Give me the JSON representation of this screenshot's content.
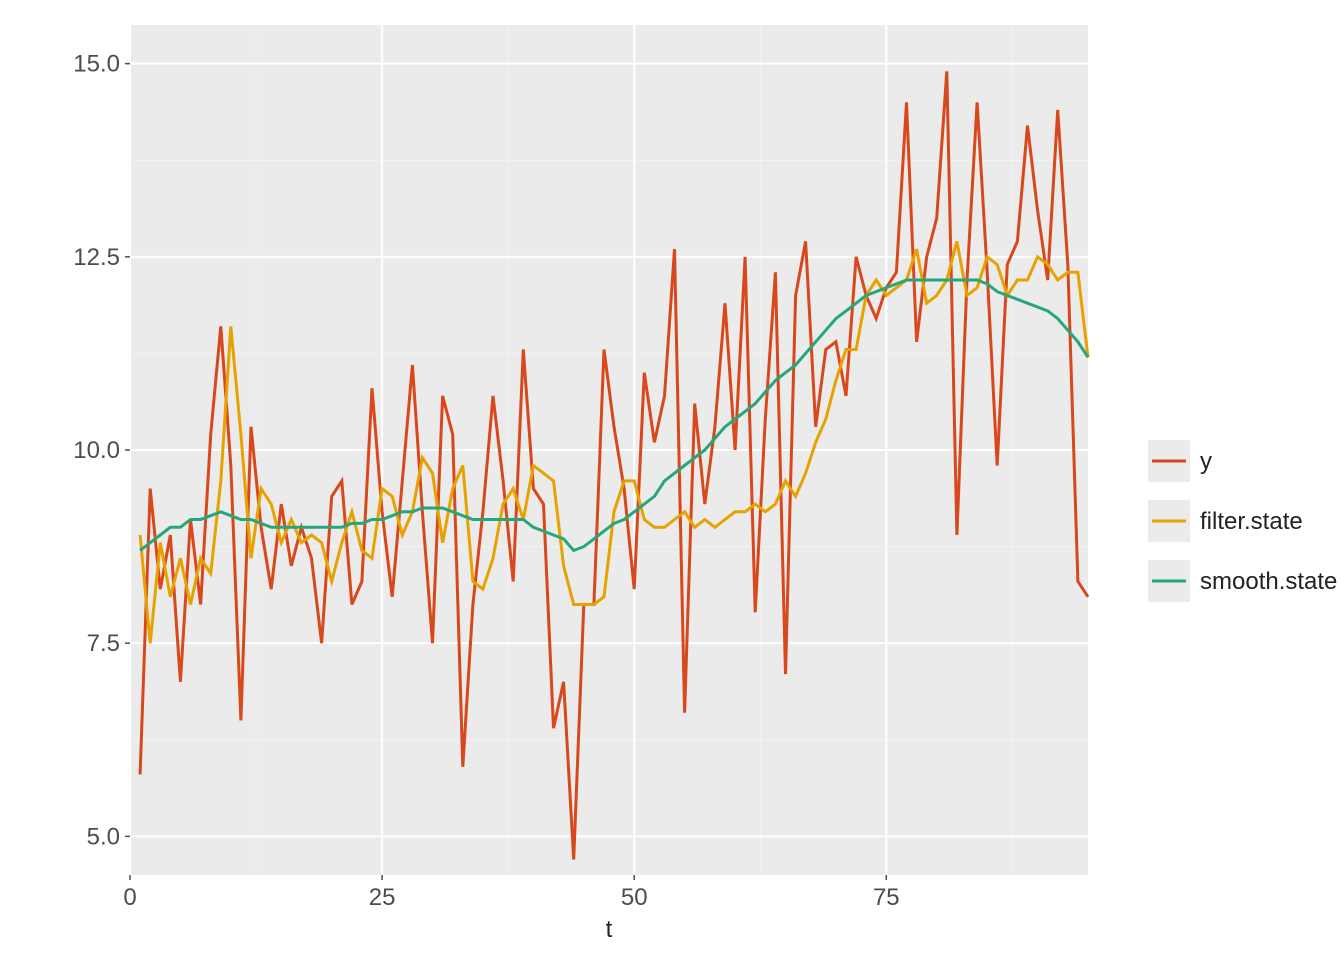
{
  "chart_data": {
    "type": "line",
    "xlabel": "t",
    "ylabel": "",
    "xlim": [
      0,
      95
    ],
    "ylim": [
      4.5,
      15.5
    ],
    "x_ticks": [
      0,
      25,
      50,
      75
    ],
    "y_ticks": [
      5.0,
      7.5,
      10.0,
      12.5,
      15.0
    ],
    "legend_position": "right",
    "series": [
      {
        "name": "y",
        "color": "#d9481c",
        "x": [
          1,
          2,
          3,
          4,
          5,
          6,
          7,
          8,
          9,
          10,
          11,
          12,
          13,
          14,
          15,
          16,
          17,
          18,
          19,
          20,
          21,
          22,
          23,
          24,
          25,
          26,
          27,
          28,
          29,
          30,
          31,
          32,
          33,
          34,
          35,
          36,
          37,
          38,
          39,
          40,
          41,
          42,
          43,
          44,
          45,
          46,
          47,
          48,
          49,
          50,
          51,
          52,
          53,
          54,
          55,
          56,
          57,
          58,
          59,
          60,
          61,
          62,
          63,
          64,
          65,
          66,
          67,
          68,
          69,
          70,
          71,
          72,
          73,
          74,
          75,
          76,
          77,
          78,
          79,
          80,
          81,
          82,
          83,
          84,
          85,
          86,
          87,
          88,
          89,
          90,
          91,
          92,
          93,
          94,
          95
        ],
        "values": [
          5.8,
          9.5,
          8.2,
          8.9,
          7.0,
          9.1,
          8.0,
          10.2,
          11.6,
          9.8,
          6.5,
          10.3,
          9.0,
          8.2,
          9.3,
          8.5,
          9.0,
          8.6,
          7.5,
          9.4,
          9.6,
          8.0,
          8.3,
          10.8,
          9.2,
          8.1,
          9.6,
          11.1,
          9.2,
          7.5,
          10.7,
          10.2,
          5.9,
          8.0,
          9.2,
          10.7,
          9.6,
          8.3,
          11.3,
          9.5,
          9.3,
          6.4,
          7.0,
          4.7,
          8.0,
          8.0,
          11.3,
          10.3,
          9.5,
          8.2,
          11.0,
          10.1,
          10.7,
          12.6,
          6.6,
          10.6,
          9.3,
          10.3,
          11.9,
          10.0,
          12.5,
          7.9,
          10.4,
          12.3,
          7.1,
          12.0,
          12.7,
          10.3,
          11.3,
          11.4,
          10.7,
          12.5,
          12.0,
          11.7,
          12.1,
          12.3,
          14.5,
          11.4,
          12.5,
          13.0,
          14.9,
          8.9,
          12.2,
          14.5,
          12.3,
          9.8,
          12.4,
          12.7,
          14.2,
          13.1,
          12.2,
          14.4,
          12.4,
          8.3,
          8.1
        ]
      },
      {
        "name": "filter.state",
        "color": "#e8a200",
        "x": [
          1,
          2,
          3,
          4,
          5,
          6,
          7,
          8,
          9,
          10,
          11,
          12,
          13,
          14,
          15,
          16,
          17,
          18,
          19,
          20,
          21,
          22,
          23,
          24,
          25,
          26,
          27,
          28,
          29,
          30,
          31,
          32,
          33,
          34,
          35,
          36,
          37,
          38,
          39,
          40,
          41,
          42,
          43,
          44,
          45,
          46,
          47,
          48,
          49,
          50,
          51,
          52,
          53,
          54,
          55,
          56,
          57,
          58,
          59,
          60,
          61,
          62,
          63,
          64,
          65,
          66,
          67,
          68,
          69,
          70,
          71,
          72,
          73,
          74,
          75,
          76,
          77,
          78,
          79,
          80,
          81,
          82,
          83,
          84,
          85,
          86,
          87,
          88,
          89,
          90,
          91,
          92,
          93,
          94,
          95
        ],
        "values": [
          8.9,
          7.5,
          8.8,
          8.1,
          8.6,
          8.0,
          8.6,
          8.4,
          9.6,
          11.6,
          10.2,
          8.6,
          9.5,
          9.3,
          8.8,
          9.1,
          8.8,
          8.9,
          8.8,
          8.3,
          8.8,
          9.2,
          8.7,
          8.6,
          9.5,
          9.4,
          8.9,
          9.2,
          9.9,
          9.7,
          8.8,
          9.5,
          9.8,
          8.3,
          8.2,
          8.6,
          9.3,
          9.5,
          9.1,
          9.8,
          9.7,
          9.6,
          8.5,
          8.0,
          8.0,
          8.0,
          8.1,
          9.2,
          9.6,
          9.6,
          9.1,
          9.0,
          9.0,
          9.1,
          9.2,
          9.0,
          9.1,
          9.0,
          9.1,
          9.2,
          9.2,
          9.3,
          9.2,
          9.3,
          9.6,
          9.4,
          9.7,
          10.1,
          10.4,
          10.9,
          11.3,
          11.3,
          12.0,
          12.2,
          12.0,
          12.1,
          12.2,
          12.6,
          11.9,
          12.0,
          12.2,
          12.7,
          12.0,
          12.1,
          12.5,
          12.4,
          12.0,
          12.2,
          12.2,
          12.5,
          12.4,
          12.2,
          12.3,
          12.3,
          11.2
        ]
      },
      {
        "name": "smooth.state",
        "color": "#26a67a",
        "x": [
          1,
          2,
          3,
          4,
          5,
          6,
          7,
          8,
          9,
          10,
          11,
          12,
          13,
          14,
          15,
          16,
          17,
          18,
          19,
          20,
          21,
          22,
          23,
          24,
          25,
          26,
          27,
          28,
          29,
          30,
          31,
          32,
          33,
          34,
          35,
          36,
          37,
          38,
          39,
          40,
          41,
          42,
          43,
          44,
          45,
          46,
          47,
          48,
          49,
          50,
          51,
          52,
          53,
          54,
          55,
          56,
          57,
          58,
          59,
          60,
          61,
          62,
          63,
          64,
          65,
          66,
          67,
          68,
          69,
          70,
          71,
          72,
          73,
          74,
          75,
          76,
          77,
          78,
          79,
          80,
          81,
          82,
          83,
          84,
          85,
          86,
          87,
          88,
          89,
          90,
          91,
          92,
          93,
          94,
          95
        ],
        "values": [
          8.7,
          8.8,
          8.9,
          9.0,
          9.0,
          9.1,
          9.1,
          9.15,
          9.2,
          9.15,
          9.1,
          9.1,
          9.05,
          9.0,
          9.0,
          9.0,
          9.0,
          9.0,
          9.0,
          9.0,
          9.0,
          9.05,
          9.05,
          9.1,
          9.1,
          9.15,
          9.2,
          9.2,
          9.25,
          9.25,
          9.25,
          9.2,
          9.15,
          9.1,
          9.1,
          9.1,
          9.1,
          9.1,
          9.1,
          9.0,
          8.95,
          8.9,
          8.85,
          8.7,
          8.75,
          8.85,
          8.95,
          9.05,
          9.1,
          9.2,
          9.3,
          9.4,
          9.6,
          9.7,
          9.8,
          9.9,
          10.0,
          10.15,
          10.3,
          10.4,
          10.5,
          10.6,
          10.75,
          10.9,
          11.0,
          11.1,
          11.25,
          11.4,
          11.55,
          11.7,
          11.8,
          11.9,
          12.0,
          12.05,
          12.1,
          12.15,
          12.2,
          12.2,
          12.2,
          12.2,
          12.2,
          12.2,
          12.2,
          12.2,
          12.15,
          12.05,
          12.0,
          11.95,
          11.9,
          11.85,
          11.8,
          11.7,
          11.55,
          11.4,
          11.2
        ]
      }
    ]
  }
}
